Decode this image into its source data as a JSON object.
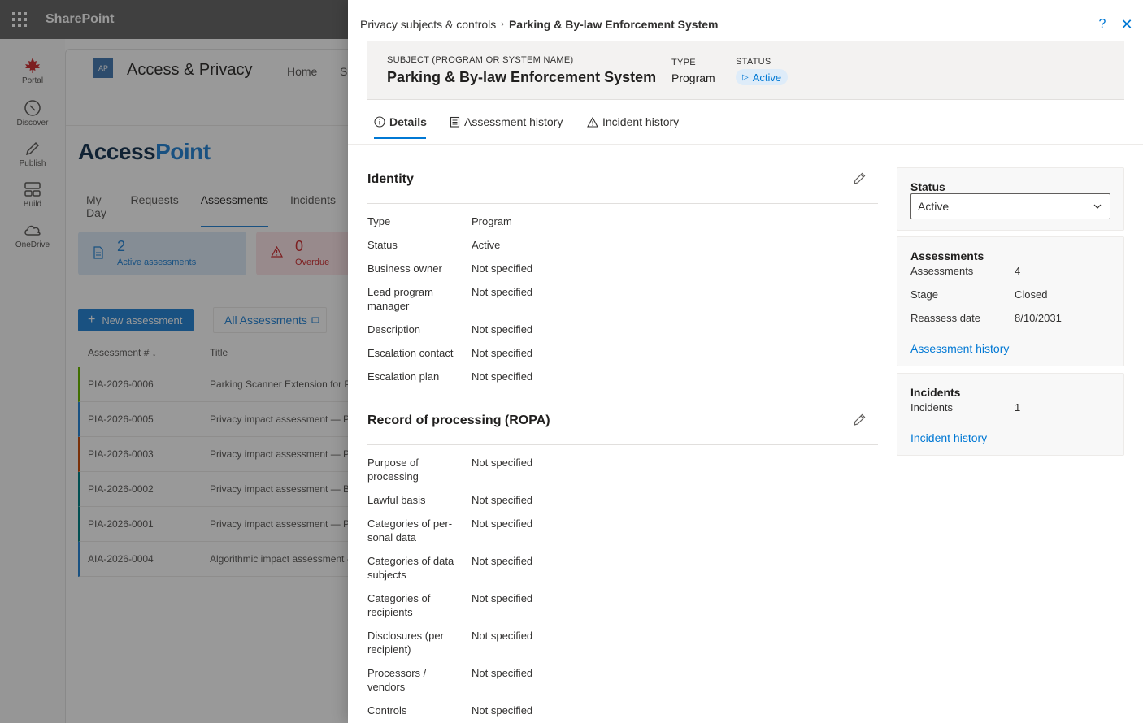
{
  "sharepoint": {
    "brand": "SharePoint",
    "rail": [
      {
        "label": "Portal",
        "icon": "maple-leaf-icon"
      },
      {
        "label": "Discover",
        "icon": "compass-icon"
      },
      {
        "label": "Publish",
        "icon": "pencil-icon"
      },
      {
        "label": "Build",
        "icon": "build-icon"
      },
      {
        "label": "OneDrive",
        "icon": "cloud-icon"
      }
    ]
  },
  "site": {
    "logo_text": "AP",
    "title": "Access & Privacy",
    "nav": [
      "Home",
      "Si"
    ],
    "app_logo_a": "Access",
    "app_logo_b": "Point",
    "tabs": [
      "My Day",
      "Requests",
      "Assessments",
      "Incidents"
    ],
    "active_tab": "Assessments",
    "kpis": [
      {
        "value": "2",
        "label": "Active assessments"
      },
      {
        "value": "0",
        "label": "Overdue"
      }
    ],
    "new_button": "New assessment",
    "view_tab": "All Assessments",
    "table": {
      "columns": [
        "Assessment #",
        "Title"
      ],
      "rows": [
        {
          "id": "PIA-2026-0006",
          "title": "Parking Scanner Extension for Pa",
          "color": "#6bb700"
        },
        {
          "id": "PIA-2026-0005",
          "title": "Privacy impact assessment — Pa",
          "color": "#2b88d8"
        },
        {
          "id": "PIA-2026-0003",
          "title": "Privacy impact assessment — Pa",
          "color": "#ca5010"
        },
        {
          "id": "PIA-2026-0002",
          "title": "Privacy impact assessment — Bu",
          "color": "#038387"
        },
        {
          "id": "PIA-2026-0001",
          "title": "Privacy impact assessment — Pa",
          "color": "#038387"
        },
        {
          "id": "AIA-2026-0004",
          "title": "Algorithmic impact assessment -",
          "color": "#2b88d8"
        }
      ]
    }
  },
  "panel": {
    "breadcrumb": {
      "parent": "Privacy subjects & controls",
      "current": "Parking & By-law Enforcement System"
    },
    "help": "?",
    "close": "✕",
    "hero": {
      "subject_label": "SUBJECT (PROGRAM OR SYSTEM NAME)",
      "subject": "Parking & By-law Enforcement System",
      "type_label": "TYPE",
      "type": "Program",
      "status_label": "STATUS",
      "status": "Active"
    },
    "tabs": [
      "Details",
      "Assessment history",
      "Incident history"
    ],
    "identity": {
      "title": "Identity",
      "fields": [
        {
          "label": "Type",
          "value": "Program"
        },
        {
          "label": "Status",
          "value": "Active"
        },
        {
          "label": "Business owner",
          "value": "Not specified"
        },
        {
          "label": "Lead program manager",
          "value": "Not specified"
        },
        {
          "label": "Description",
          "value": "Not specified"
        },
        {
          "label": "Escalation contact",
          "value": "Not specified"
        },
        {
          "label": "Escalation plan",
          "value": "Not specified"
        }
      ]
    },
    "ropa": {
      "title": "Record of processing (ROPA)",
      "fields": [
        {
          "label": "Purpose of processing",
          "value": "Not specified"
        },
        {
          "label": "Lawful basis",
          "value": "Not specified"
        },
        {
          "label": "Categories of per-sonal data",
          "value": "Not specified"
        },
        {
          "label": "Categories of data subjects",
          "value": "Not specified"
        },
        {
          "label": "Categories of recipients",
          "value": "Not specified"
        },
        {
          "label": "Disclosures (per recipient)",
          "value": "Not specified"
        },
        {
          "label": "Processors / vendors",
          "value": "Not specified"
        },
        {
          "label": "Controls",
          "value": "Not specified"
        }
      ]
    },
    "status_card": {
      "title": "Status",
      "selected": "Active"
    },
    "assessments_card": {
      "title": "Assessments",
      "rows": [
        {
          "k": "Assessments",
          "v": "4"
        },
        {
          "k": "Stage",
          "v": "Closed"
        },
        {
          "k": "Reassess date",
          "v": "8/10/2031"
        }
      ],
      "link": "Assessment history"
    },
    "incidents_card": {
      "title": "Incidents",
      "rows": [
        {
          "k": "Incidents",
          "v": "1"
        }
      ],
      "link": "Incident history"
    }
  }
}
